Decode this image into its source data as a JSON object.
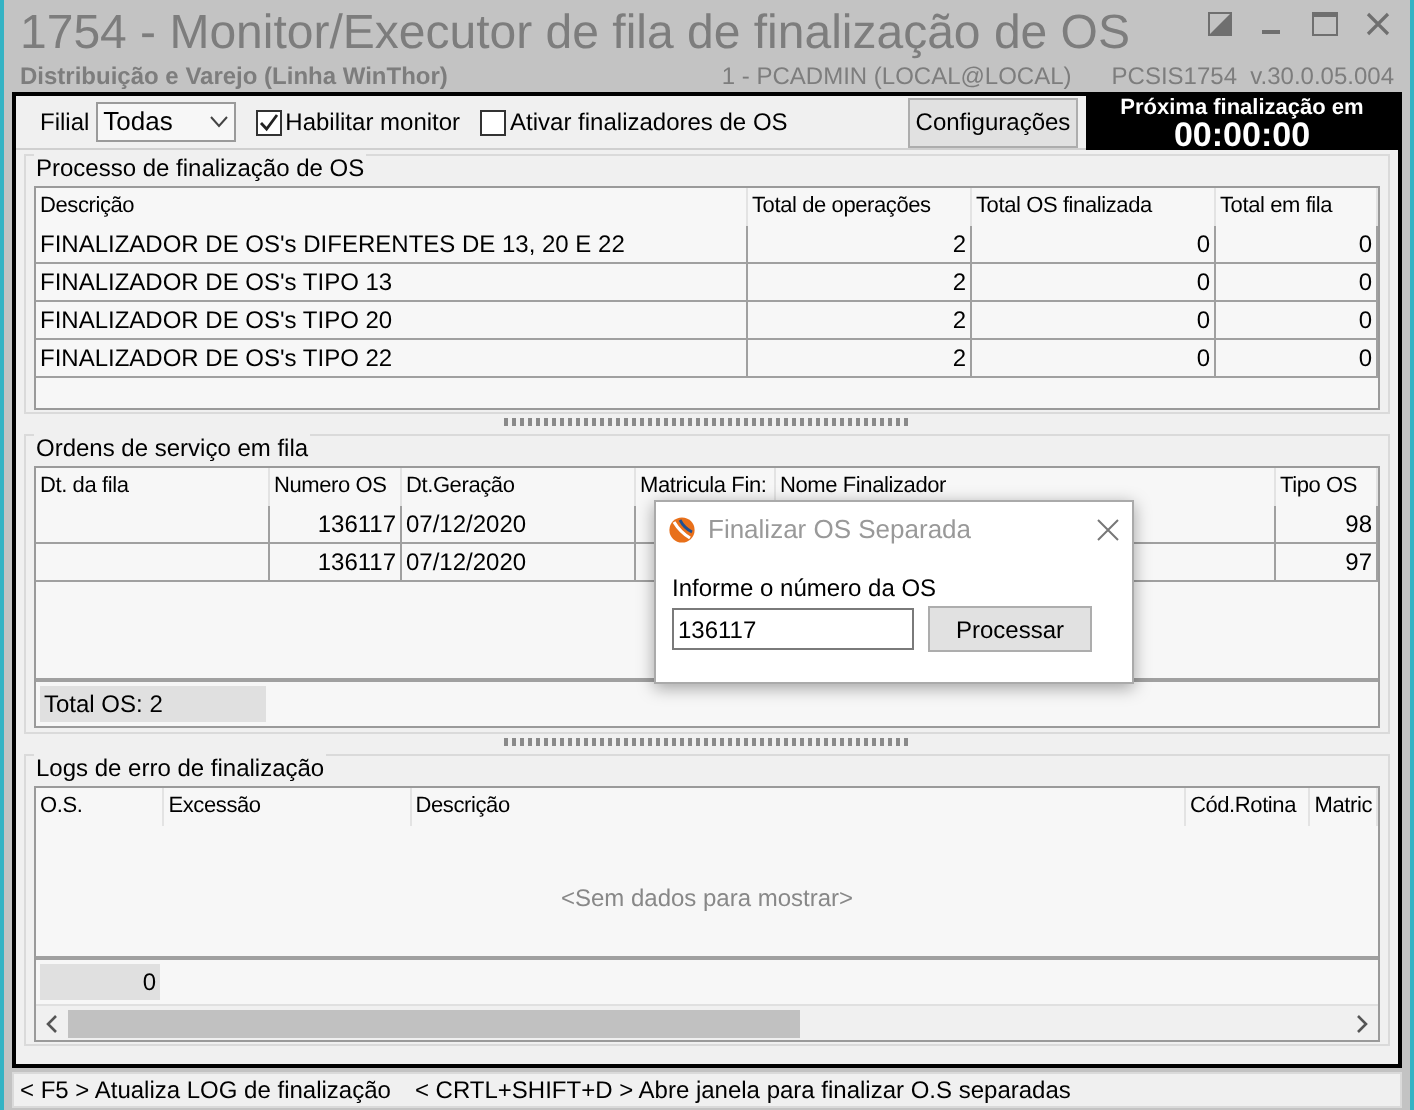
{
  "window": {
    "title": "1754 - Monitor/Executor de fila de finalização de OS",
    "subtitle": "Distribuição e Varejo (Linha WinThor)",
    "user": "1 - PCADMIN (LOCAL@LOCAL)",
    "version": "PCSIS1754  v.30.0.05.004"
  },
  "toolbar": {
    "filial_label": "Filial",
    "filial_value": "Todas",
    "checkboxes": [
      {
        "label": "Habilitar monitor",
        "checked": true
      },
      {
        "label": "Ativar finalizadores de OS",
        "checked": false
      }
    ],
    "config_button": "Configurações",
    "timer_label": "Próxima finalização em",
    "timer": "00:00:00"
  },
  "process_group": {
    "title": "Processo de finalização de OS",
    "columns": [
      "Descrição",
      "Total de operações",
      "Total OS finalizada",
      "Total em fila"
    ],
    "rows": [
      [
        "FINALIZADOR DE OS's DIFERENTES DE 13, 20 E 22",
        "2",
        "0",
        "0"
      ],
      [
        "FINALIZADOR DE OS's TIPO 13",
        "2",
        "0",
        "0"
      ],
      [
        "FINALIZADOR DE OS's TIPO 20",
        "2",
        "0",
        "0"
      ],
      [
        "FINALIZADOR DE OS's TIPO 22",
        "2",
        "0",
        "0"
      ]
    ]
  },
  "queue_group": {
    "title": "Ordens de serviço em fila",
    "columns": [
      "Dt. da fila",
      "Numero OS",
      "Dt.Geração",
      "Matricula Fin:",
      "Nome Finalizador",
      "Tipo OS"
    ],
    "rows": [
      [
        "",
        "136117",
        "07/12/2020",
        "",
        "",
        "98"
      ],
      [
        "",
        "136117",
        "07/12/2020",
        "",
        "",
        "97"
      ]
    ],
    "total": "Total OS: 2"
  },
  "logs_group": {
    "title": "Logs de erro de finalização",
    "columns": [
      "O.S.",
      "Excessão",
      "Descrição",
      "Cód.Rotina",
      "Matric"
    ],
    "empty_text": "<Sem dados para mostrar>",
    "footer_count": "0"
  },
  "status_bar": {
    "hints": [
      "< F5 > Atualiza LOG de finalização",
      "< CRTL+SHIFT+D > Abre janela para finalizar O.S separadas"
    ]
  },
  "dialog": {
    "title": "Finalizar OS Separada",
    "label": "Informe o número da OS",
    "value": "136117",
    "button": "Processar"
  }
}
